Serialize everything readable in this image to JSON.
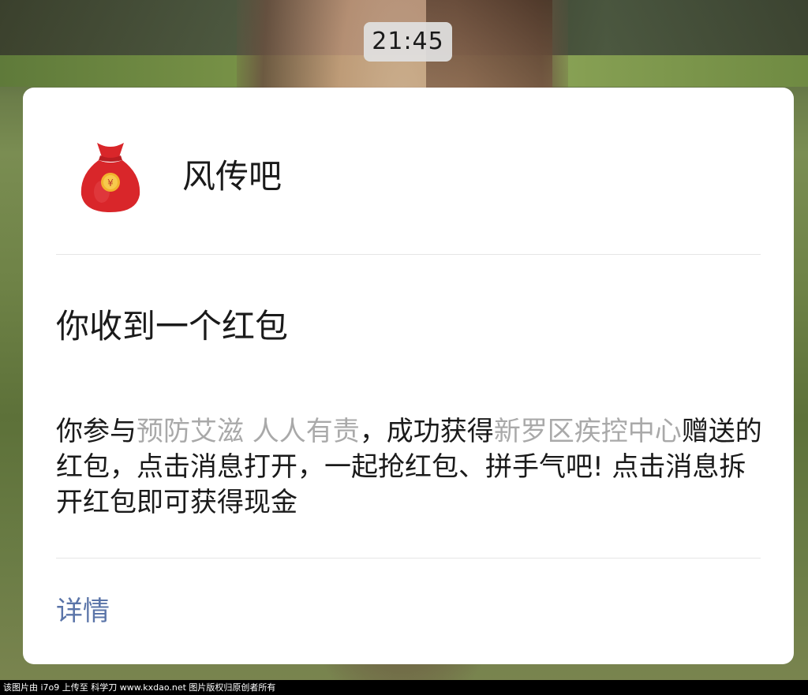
{
  "status": {
    "time": "21:45"
  },
  "card": {
    "app_name": "风传吧",
    "app_icon": "red-money-bag-icon",
    "title": "你收到一个红包",
    "body": {
      "prefix": "你参与",
      "campaign": "预防艾滋 人人有责",
      "mid": "，成功获得",
      "sender": "新罗区疾控中心",
      "suffix": "赠送的红包，点击消息打开，一起抢红包、拼手气吧! 点击消息拆开红包即可获得现金"
    },
    "details_label": "详情"
  },
  "watermark": {
    "text": "该图片由 i7o9 上传至 科学刀 www.kxdao.net 图片版权归原创者所有"
  },
  "colors": {
    "card_bg": "#ffffff",
    "highlight_text": "#a9a9a9",
    "link": "#5a74a8",
    "bag_red": "#d9262a",
    "coin_gold": "#f2b32e"
  }
}
